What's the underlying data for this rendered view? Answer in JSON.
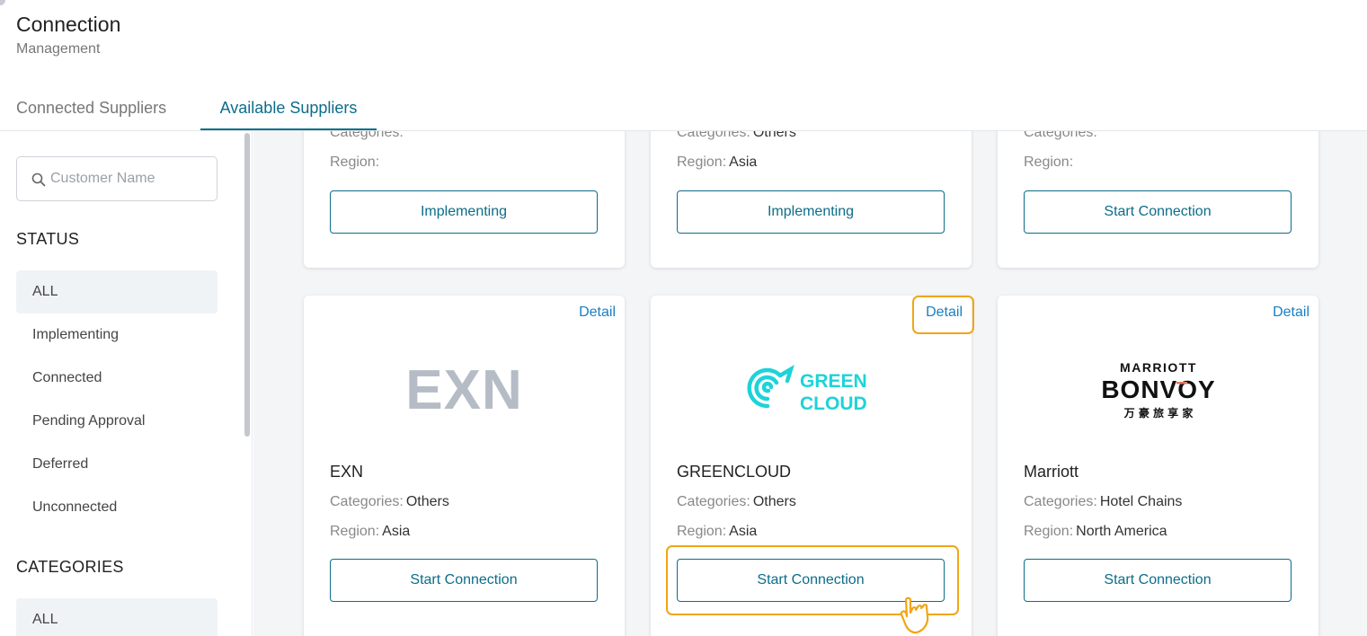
{
  "header": {
    "title": "Connection",
    "subtitle": "Management"
  },
  "tabs": [
    {
      "label": "Connected Suppliers",
      "active": false
    },
    {
      "label": "Available Suppliers",
      "active": true
    }
  ],
  "sidebar": {
    "search": {
      "placeholder": "Customer Name",
      "value": ""
    },
    "status": {
      "heading": "STATUS",
      "items": [
        "ALL",
        "Implementing",
        "Connected",
        "Pending Approval",
        "Deferred",
        "Unconnected"
      ],
      "active": "ALL"
    },
    "categories": {
      "heading": "CATEGORIES",
      "items": [
        "ALL"
      ],
      "active": "ALL"
    }
  },
  "labels": {
    "categories": "Categories:",
    "region": "Region:",
    "detail": "Detail"
  },
  "top_row_cards": [
    {
      "categories": "",
      "region": "",
      "button": "Implementing"
    },
    {
      "categories": "Others",
      "region": "Asia",
      "button": "Implementing"
    },
    {
      "categories": "",
      "region": "",
      "button": "Start Connection"
    }
  ],
  "cards": [
    {
      "logo_text": "EXN",
      "name": "EXN",
      "categories": "Others",
      "region": "Asia",
      "button": "Start Connection"
    },
    {
      "logo_text": [
        "GREEN",
        "CLOUD"
      ],
      "name": "GREENCLOUD",
      "categories": "Others",
      "region": "Asia",
      "button": "Start Connection"
    },
    {
      "logo_text": [
        "MARRIOTT",
        "BONVOY",
        "万 豪 旅 享 家"
      ],
      "name": "Marriott",
      "categories": "Hotel Chains",
      "region": "North America",
      "button": "Start Connection"
    }
  ],
  "colors": {
    "accent": "#0c6d8a",
    "link": "#1a7fc1",
    "highlight": "#f2a514",
    "greencloud": "#1dd3d8",
    "marriott_accent": "#e07a5f"
  }
}
